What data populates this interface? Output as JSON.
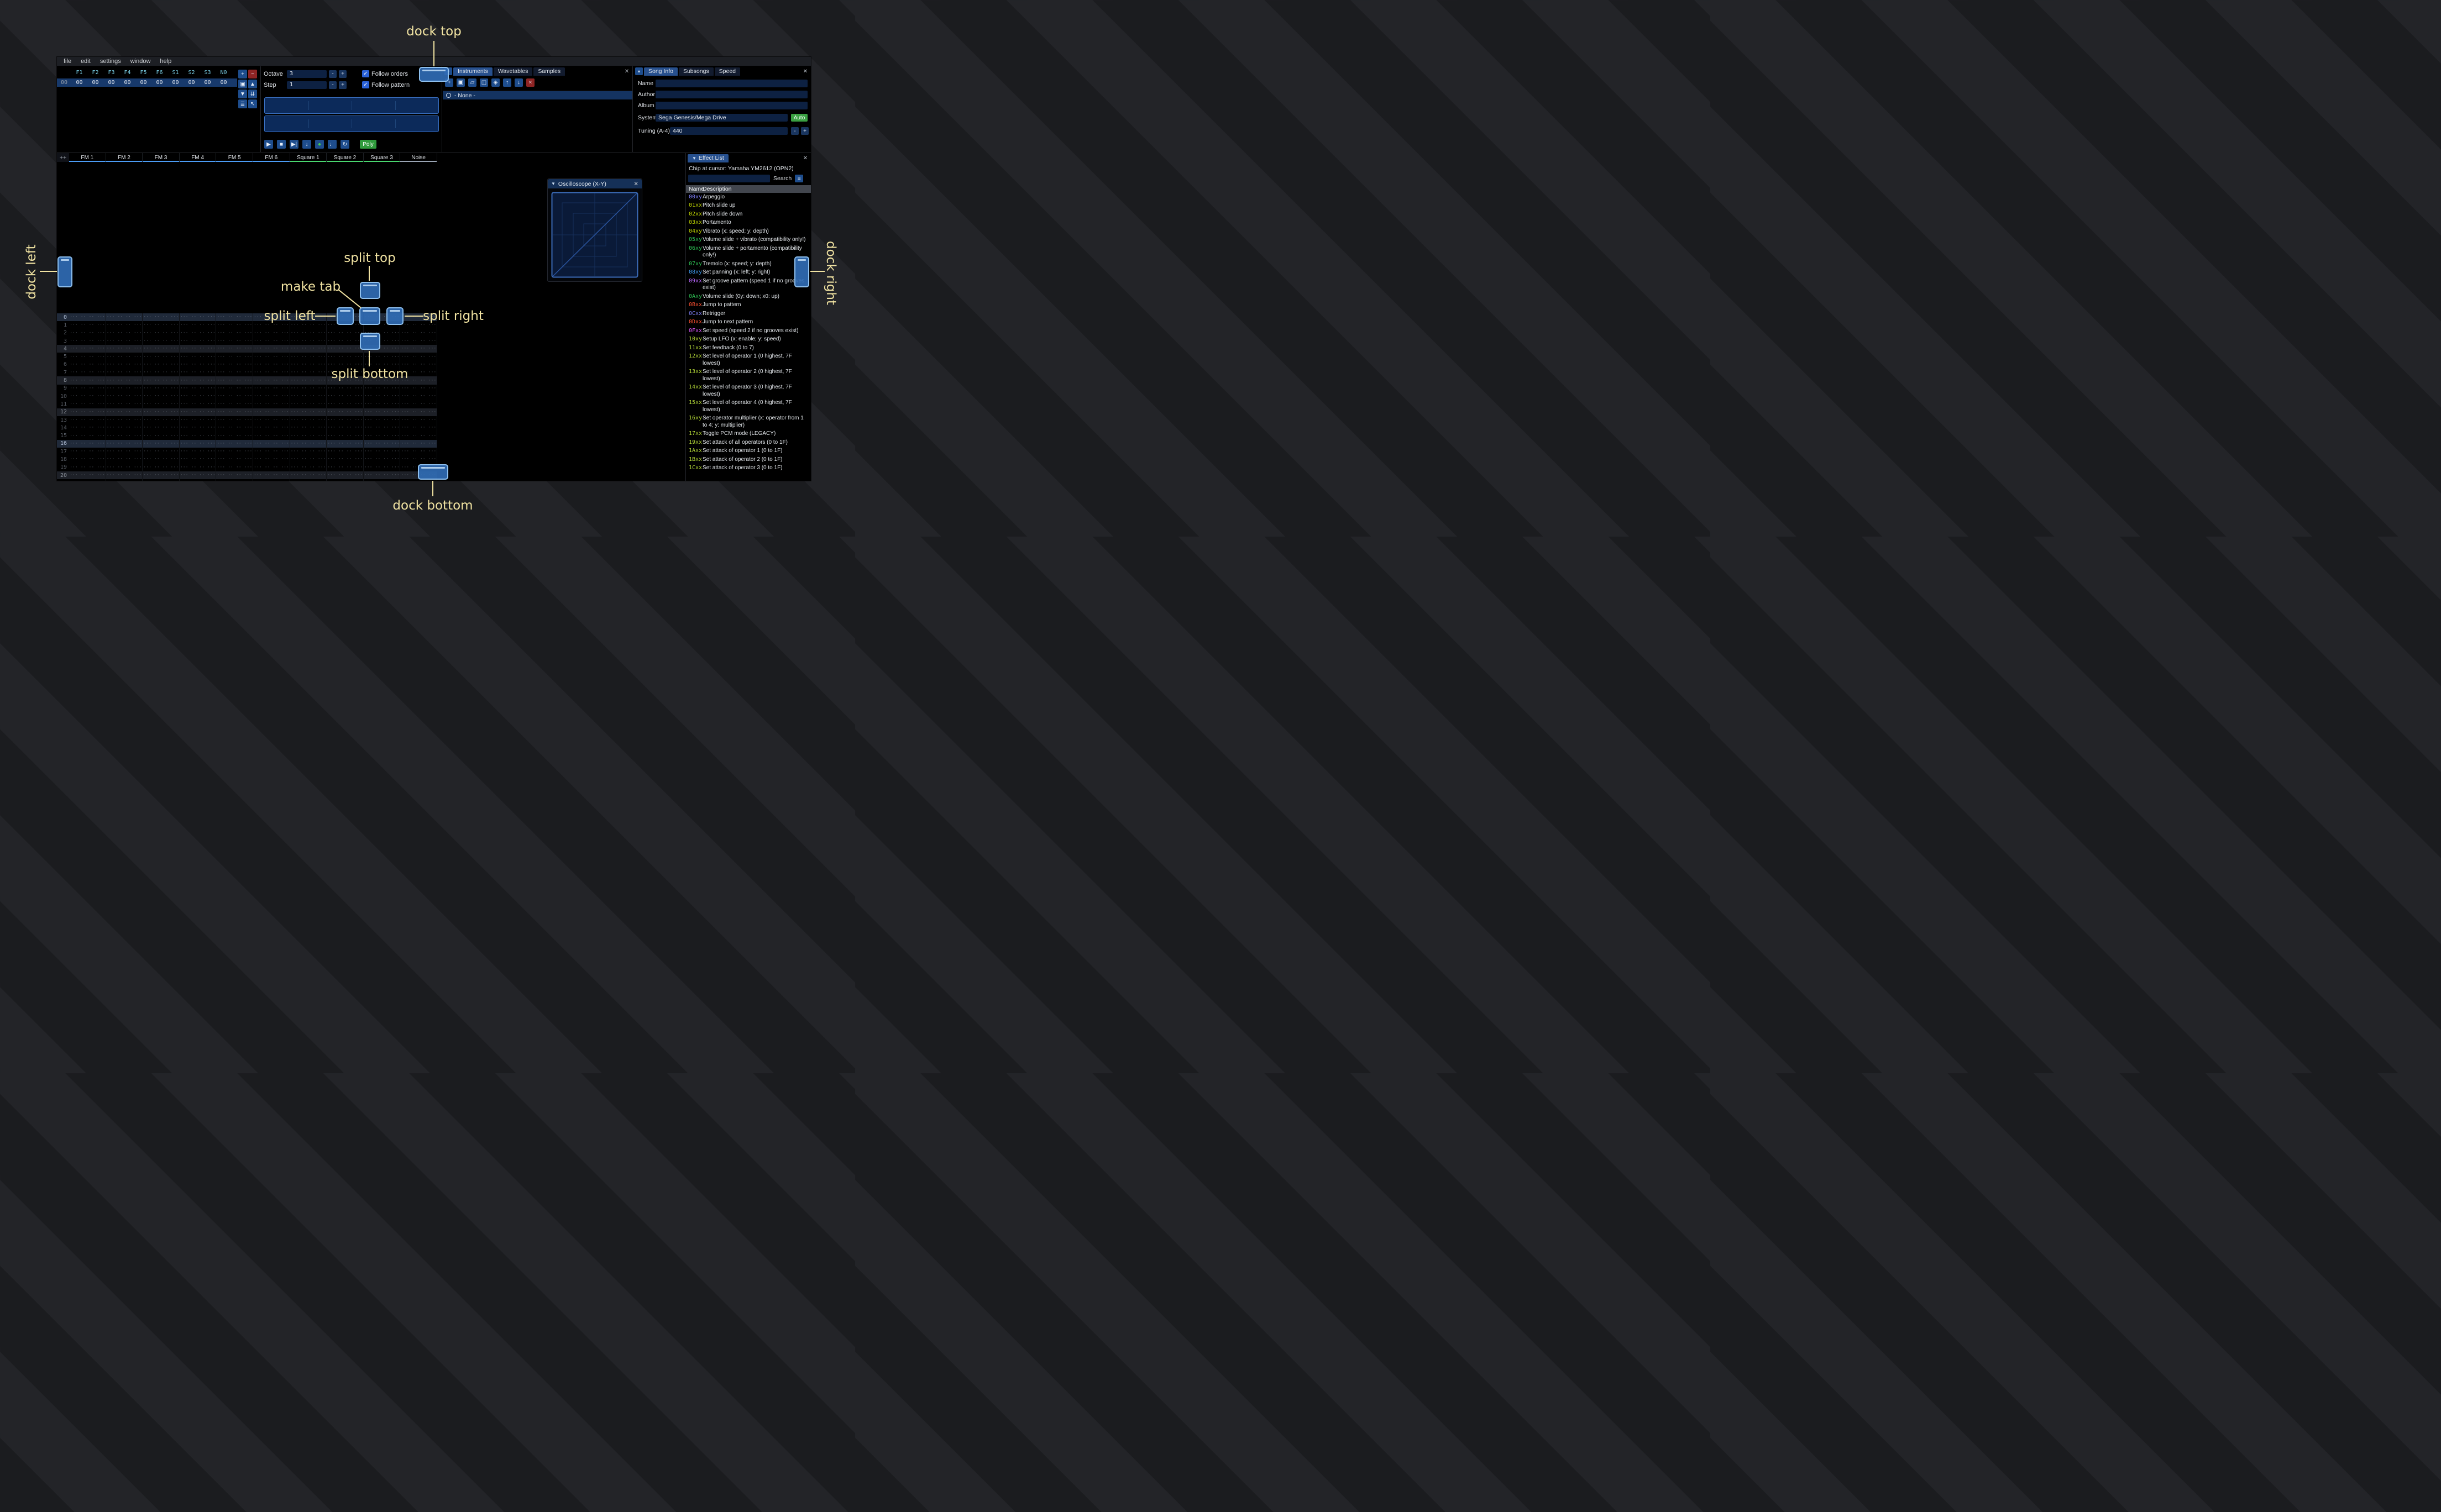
{
  "menu": {
    "items": [
      "file",
      "edit",
      "settings",
      "window",
      "help"
    ]
  },
  "orders": {
    "channel_headers": [
      "F1",
      "F2",
      "F3",
      "F4",
      "F5",
      "F6",
      "S1",
      "S2",
      "S3",
      "N0"
    ],
    "rows": [
      {
        "index": "00",
        "values": [
          "00",
          "00",
          "00",
          "00",
          "00",
          "00",
          "00",
          "00",
          "00",
          "00"
        ]
      }
    ],
    "buttons": [
      {
        "name": "order-add-button",
        "glyph": "+",
        "style": "blue"
      },
      {
        "name": "order-remove-button",
        "glyph": "−",
        "style": "red"
      },
      {
        "name": "order-duplicate-button",
        "glyph": "▣",
        "style": "blue"
      },
      {
        "name": "order-move-up-button",
        "glyph": "▲",
        "style": "blue"
      },
      {
        "name": "order-move-down-button",
        "glyph": "▼",
        "style": "blue"
      },
      {
        "name": "order-deep-clone-button",
        "glyph": "⇊",
        "style": "blue"
      },
      {
        "name": "order-change-all-button",
        "glyph": "≣",
        "style": "blue"
      },
      {
        "name": "order-edit-mode-button",
        "glyph": "↖",
        "style": "blue"
      }
    ]
  },
  "controls": {
    "octave_label": "Octave",
    "octave_value": "3",
    "step_label": "Step",
    "step_value": "1",
    "minus_label": "-",
    "plus_label": "+",
    "check_icon": "✓",
    "follow_orders_label": "Follow orders",
    "follow_pattern_label": "Follow pattern",
    "playback_buttons": [
      {
        "name": "play-button",
        "glyph": "▶"
      },
      {
        "name": "stop-button",
        "glyph": "■"
      },
      {
        "name": "play-once-button",
        "glyph": "▶|"
      },
      {
        "name": "step-row-button",
        "glyph": "↓"
      },
      {
        "name": "record-button",
        "glyph": "●",
        "accent": "#45d14d"
      },
      {
        "name": "metronome-button",
        "glyph": "♩"
      },
      {
        "name": "repeat-button",
        "glyph": "↻"
      }
    ],
    "poly_label": "Poly"
  },
  "instruments": {
    "dropdown_icon": "▾",
    "tabs": [
      {
        "label": "Instruments",
        "active": true
      },
      {
        "label": "Wavetables",
        "active": false
      },
      {
        "label": "Samples",
        "active": false
      }
    ],
    "toolbar": [
      {
        "name": "instrument-add-button",
        "glyph": "+",
        "style": "blue"
      },
      {
        "name": "instrument-duplicate-button",
        "glyph": "▣",
        "style": "blue"
      },
      {
        "name": "instrument-open-button",
        "glyph": "▱",
        "style": "blue"
      },
      {
        "name": "instrument-save-button",
        "glyph": "◫",
        "style": "blue"
      },
      {
        "name": "instrument-sort-button",
        "glyph": "◈",
        "style": "blue"
      },
      {
        "name": "instrument-move-up-button",
        "glyph": "↑",
        "style": "blue"
      },
      {
        "name": "instrument-move-down-button",
        "glyph": "↓",
        "style": "blue"
      },
      {
        "name": "instrument-delete-button",
        "glyph": "×",
        "style": "red"
      }
    ],
    "none_label": "- None -",
    "close_label": "✕"
  },
  "song_info": {
    "dropdown_icon": "▾",
    "tabs": [
      {
        "label": "Song Info",
        "active": true
      },
      {
        "label": "Subsongs",
        "active": false
      },
      {
        "label": "Speed",
        "active": false
      }
    ],
    "name_label": "Name",
    "name_value": "",
    "author_label": "Author",
    "author_value": "",
    "album_label": "Album",
    "album_value": "",
    "system_label": "System",
    "system_value": "Sega Genesis/Mega Drive",
    "auto_label": "Auto",
    "tuning_label": "Tuning (A-4)",
    "tuning_value": "440",
    "minus_label": "-",
    "plus_label": "+",
    "close_label": "✕"
  },
  "pattern": {
    "add_channel_label": "++",
    "channels": [
      {
        "name": "FM 1",
        "color": "#4b9cf5"
      },
      {
        "name": "FM 2",
        "color": "#4b9cf5"
      },
      {
        "name": "FM 3",
        "color": "#4b9cf5"
      },
      {
        "name": "FM 4",
        "color": "#4b9cf5"
      },
      {
        "name": "FM 5",
        "color": "#4b9cf5"
      },
      {
        "name": "FM 6",
        "color": "#4b9cf5"
      },
      {
        "name": "Square 1",
        "color": "#49d66e"
      },
      {
        "name": "Square 2",
        "color": "#49d66e"
      },
      {
        "name": "Square 3",
        "color": "#49d66e"
      },
      {
        "name": "Noise",
        "color": "#9aa5b4"
      }
    ],
    "row_count": 22,
    "empty_cell": "··· ·· ·· ···",
    "highlight_minor": 4,
    "highlight_major": 16
  },
  "oscilloscope": {
    "collapse_icon": "▼",
    "title": "Oscilloscope (X-Y)",
    "close_label": "✕"
  },
  "effect_list": {
    "collapse_icon": "▼",
    "tab_label": "Effect List",
    "close_label": "✕",
    "chip_line": "Chip at cursor: Yamaha YM2612 (OPN2)",
    "search_label": "Search",
    "search_value": "",
    "menu_icon": "≡",
    "name_header": "Name",
    "description_header": "Description",
    "effects": [
      {
        "code": "00xy",
        "color": "#8282ff",
        "desc": "Arpeggio"
      },
      {
        "code": "01xx",
        "color": "#bfd400",
        "desc": "Pitch slide up"
      },
      {
        "code": "02xx",
        "color": "#bfd400",
        "desc": "Pitch slide down"
      },
      {
        "code": "03xx",
        "color": "#bfd400",
        "desc": "Portamento"
      },
      {
        "code": "04xy",
        "color": "#bfd400",
        "desc": "Vibrato (x: speed; y: depth)"
      },
      {
        "code": "05xy",
        "color": "#2fc456",
        "desc": "Volume slide + vibrato (compatibility only!)"
      },
      {
        "code": "06xy",
        "color": "#2fc456",
        "desc": "Volume slide + portamento (compatibility only!)"
      },
      {
        "code": "07xy",
        "color": "#2fc456",
        "desc": "Tremolo (x: speed; y: depth)"
      },
      {
        "code": "08xy",
        "color": "#3f9df2",
        "desc": "Set panning (x: left; y: right)"
      },
      {
        "code": "09xx",
        "color": "#bb68ff",
        "desc": "Set groove pattern (speed 1 if no grooves exist)"
      },
      {
        "code": "0Axy",
        "color": "#2fc456",
        "desc": "Volume slide (0y: down; x0: up)"
      },
      {
        "code": "0Bxx",
        "color": "#ff5233",
        "desc": "Jump to pattern"
      },
      {
        "code": "0Cxx",
        "color": "#8282ff",
        "desc": "Retrigger"
      },
      {
        "code": "0Dxx",
        "color": "#ff5233",
        "desc": "Jump to next pattern"
      },
      {
        "code": "0Fxx",
        "color": "#e058ff",
        "desc": "Set speed (speed 2 if no grooves exist)"
      },
      {
        "code": "10xy",
        "color": "#b4d838",
        "desc": "Setup LFO (x: enable; y: speed)"
      },
      {
        "code": "11xx",
        "color": "#b4d838",
        "desc": "Set feedback (0 to 7)"
      },
      {
        "code": "12xx",
        "color": "#b4d838",
        "desc": "Set level of operator 1 (0 highest, 7F lowest)"
      },
      {
        "code": "13xx",
        "color": "#b4d838",
        "desc": "Set level of operator 2 (0 highest, 7F lowest)"
      },
      {
        "code": "14xx",
        "color": "#b4d838",
        "desc": "Set level of operator 3 (0 highest, 7F lowest)"
      },
      {
        "code": "15xx",
        "color": "#b4d838",
        "desc": "Set level of operator 4 (0 highest, 7F lowest)"
      },
      {
        "code": "16xy",
        "color": "#b4d838",
        "desc": "Set operator multiplier (x: operator from 1 to 4; y: multiplier)"
      },
      {
        "code": "17xx",
        "color": "#b4d838",
        "desc": "Toggle PCM mode (LEGACY)"
      },
      {
        "code": "19xx",
        "color": "#b4d838",
        "desc": "Set attack of all operators (0 to 1F)"
      },
      {
        "code": "1Axx",
        "color": "#b4d838",
        "desc": "Set attack of operator 1 (0 to 1F)"
      },
      {
        "code": "1Bxx",
        "color": "#b4d838",
        "desc": "Set attack of operator 2 (0 to 1F)"
      },
      {
        "code": "1Cxx",
        "color": "#b4d838",
        "desc": "Set attack of operator 3 (0 to 1F)"
      }
    ]
  },
  "dock_overlay": {
    "accent": "#f1e3a2",
    "labels": {
      "dock_top": "dock top",
      "dock_left": "dock left",
      "dock_right": "dock right",
      "dock_bottom": "dock bottom",
      "split_top": "split top",
      "split_left": "split left",
      "split_right": "split right",
      "split_bottom": "split bottom",
      "make_tab": "make tab"
    }
  }
}
